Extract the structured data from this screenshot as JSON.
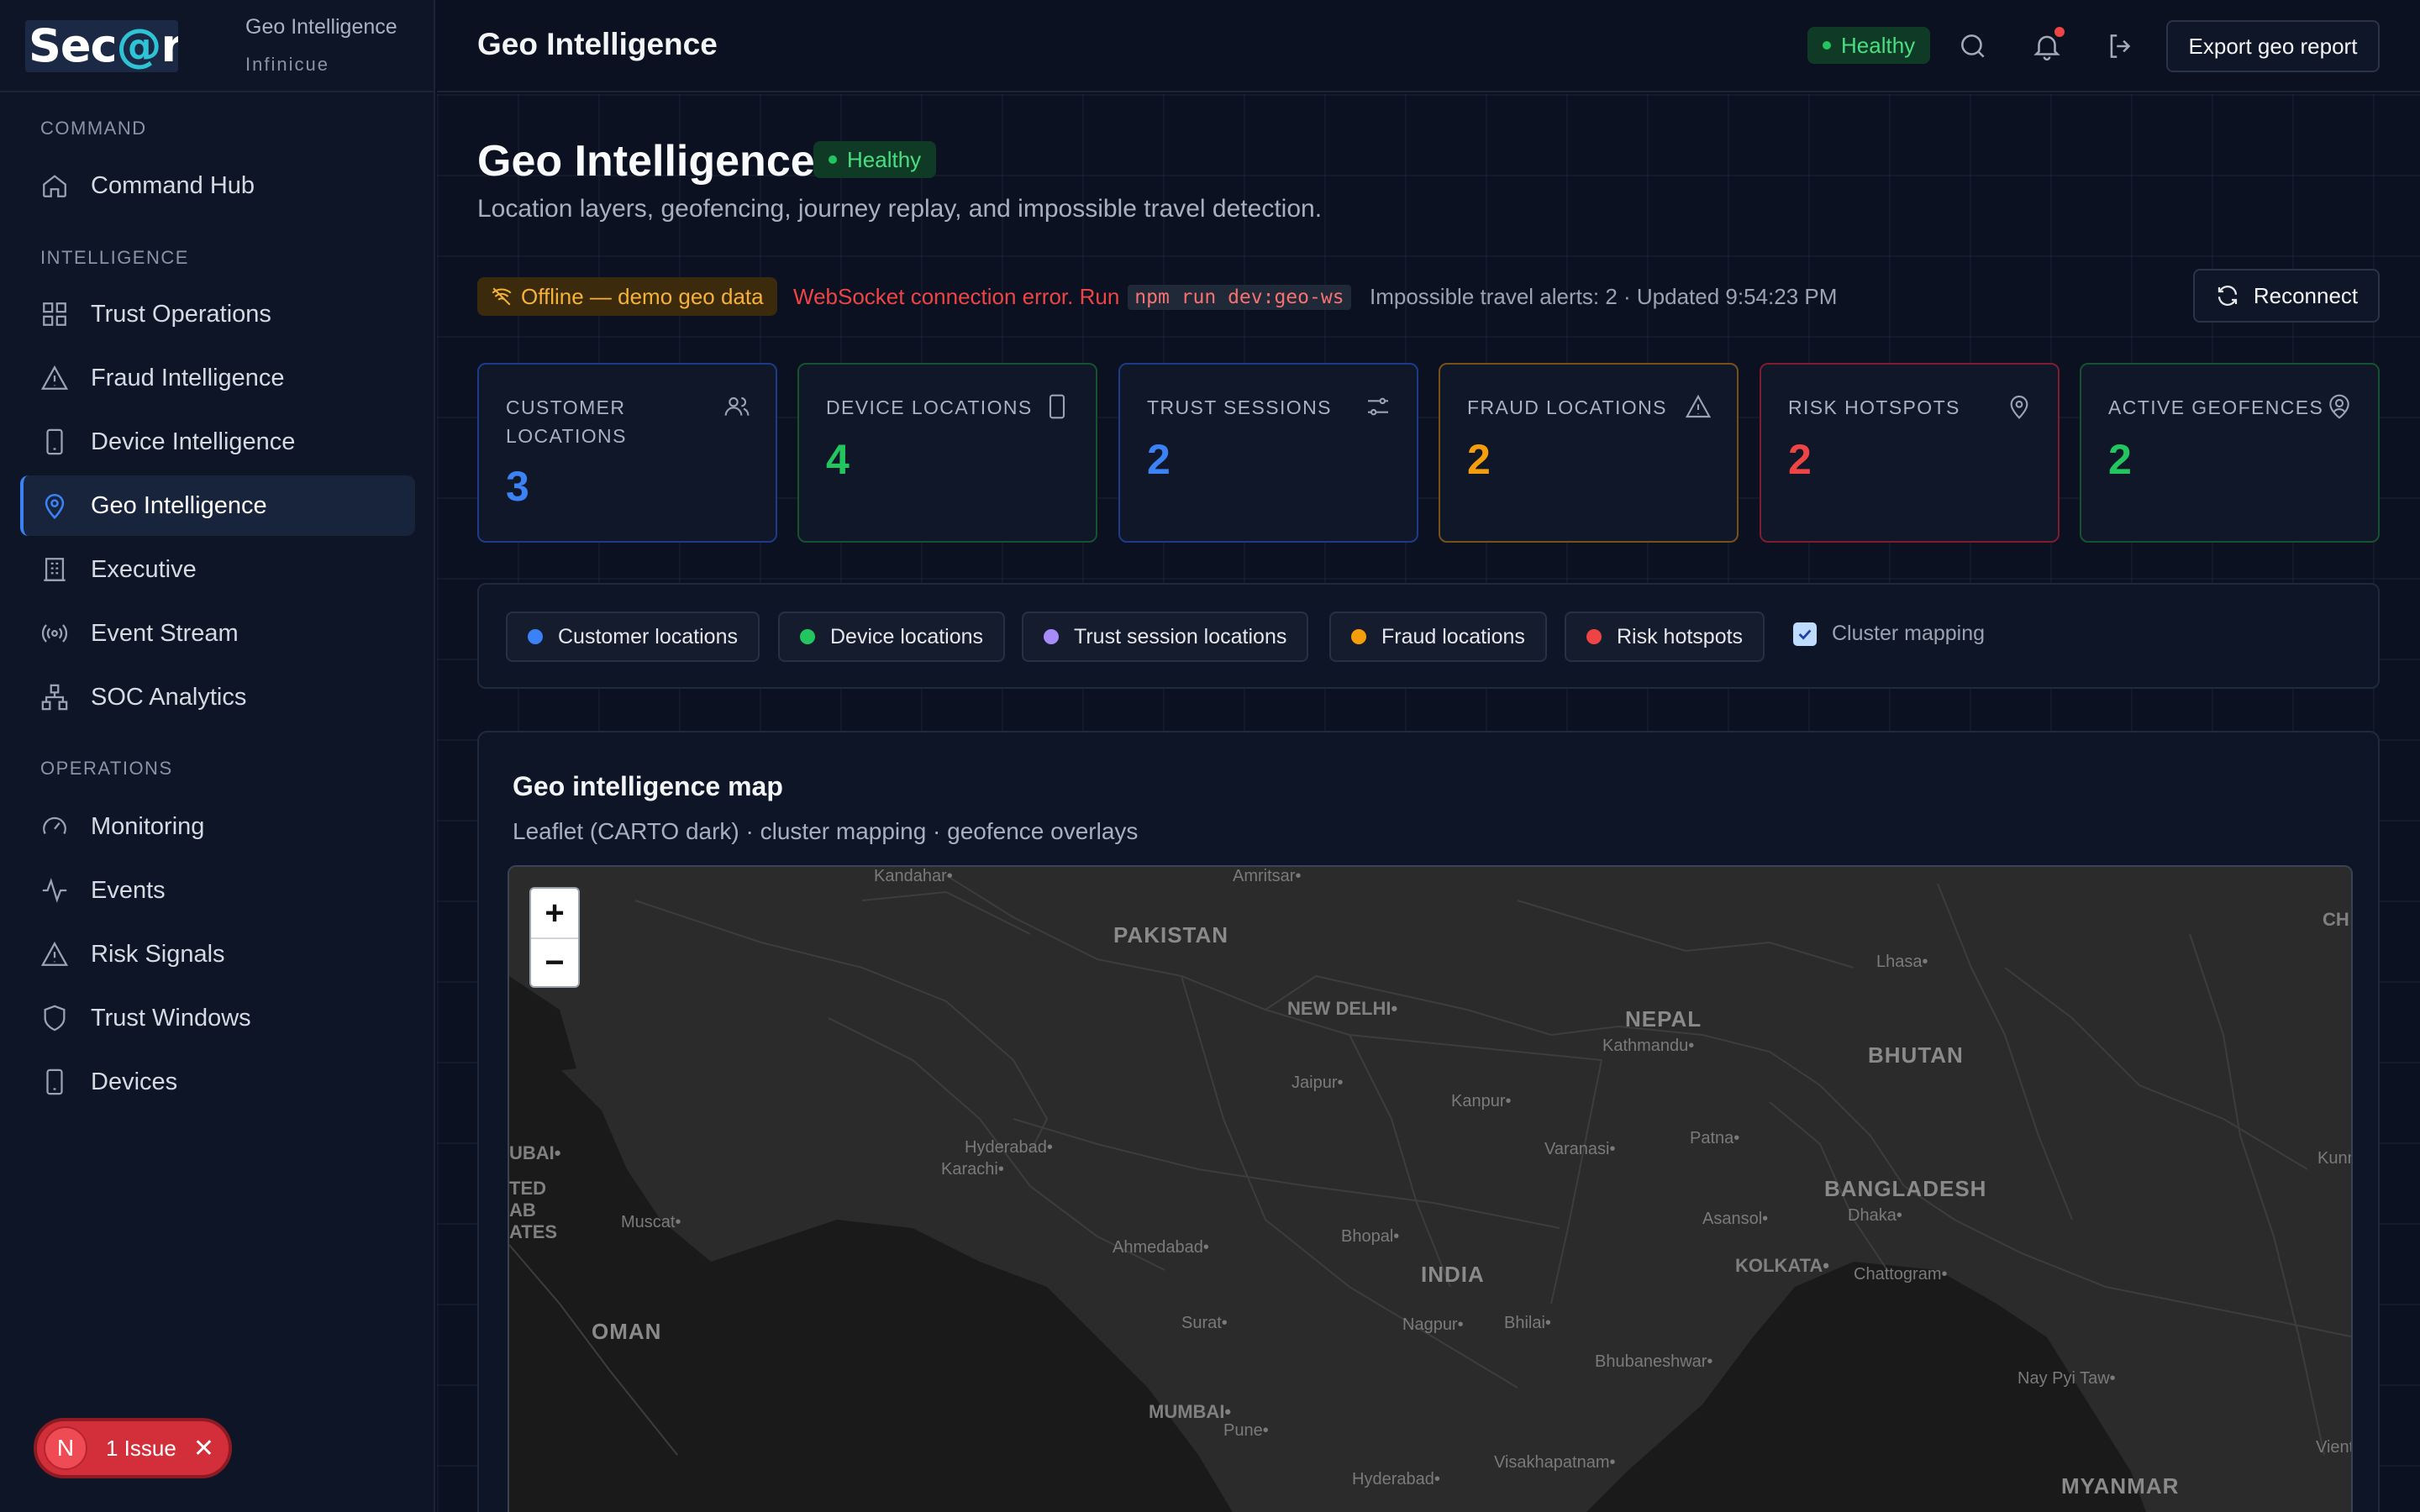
{
  "sidebar": {
    "logo": {
      "pre": "Sec",
      "at": "@",
      "post": "r"
    },
    "brand_title": "Geo Intelligence",
    "brand_sub": "Infinicue",
    "sections": [
      {
        "label": "COMMAND",
        "items": [
          {
            "label": "Command Hub",
            "icon": "home-icon"
          }
        ]
      },
      {
        "label": "INTELLIGENCE",
        "items": [
          {
            "label": "Trust Operations",
            "icon": "grid-icon"
          },
          {
            "label": "Fraud Intelligence",
            "icon": "warning-icon"
          },
          {
            "label": "Device Intelligence",
            "icon": "device-icon"
          },
          {
            "label": "Geo Intelligence",
            "icon": "map-pin-icon",
            "active": true
          },
          {
            "label": "Executive",
            "icon": "building-icon"
          },
          {
            "label": "Event Stream",
            "icon": "broadcast-icon"
          },
          {
            "label": "SOC Analytics",
            "icon": "network-icon"
          }
        ]
      },
      {
        "label": "OPERATIONS",
        "items": [
          {
            "label": "Monitoring",
            "icon": "gauge-icon"
          },
          {
            "label": "Events",
            "icon": "activity-icon"
          },
          {
            "label": "Risk Signals",
            "icon": "warning-icon"
          },
          {
            "label": "Trust Windows",
            "icon": "shield-icon"
          },
          {
            "label": "Devices",
            "icon": "device-icon"
          }
        ]
      }
    ],
    "issue": {
      "letter": "N",
      "label": "1 Issue"
    }
  },
  "topbar": {
    "title": "Geo Intelligence",
    "status": "Healthy",
    "export_label": "Export geo report"
  },
  "page": {
    "title": "Geo Intelligence",
    "status": "Healthy",
    "description": "Location layers, geofencing, journey replay, and impossible travel detection.",
    "offline_label": "Offline — demo geo data",
    "ws_error": "WebSocket connection error. Run",
    "ws_command": "npm run dev:geo-ws",
    "alerts_text": "Impossible travel alerts: 2 · Updated 9:54:23 PM",
    "reconnect_label": "Reconnect"
  },
  "stats": [
    {
      "label": "CUSTOMER LOCATIONS",
      "value": "3",
      "icon": "users-icon",
      "color": "#3b82f6",
      "border": "#1e3a8a"
    },
    {
      "label": "DEVICE LOCATIONS",
      "value": "4",
      "icon": "device-icon",
      "color": "#22c55e",
      "border": "#14532d"
    },
    {
      "label": "TRUST SESSIONS",
      "value": "2",
      "icon": "sliders-icon",
      "color": "#3b82f6",
      "border": "#1e3a8a"
    },
    {
      "label": "FRAUD LOCATIONS",
      "value": "2",
      "icon": "warning-icon",
      "color": "#f59e0b",
      "border": "#78501a"
    },
    {
      "label": "RISK HOTSPOTS",
      "value": "2",
      "icon": "map-pin-icon",
      "color": "#ef4444",
      "border": "#7f1d2d"
    },
    {
      "label": "ACTIVE GEOFENCES",
      "value": "2",
      "icon": "user-pin-icon",
      "color": "#22c55e",
      "border": "#14532d"
    }
  ],
  "layers": [
    {
      "label": "Customer locations",
      "color": "#3b82f6"
    },
    {
      "label": "Device locations",
      "color": "#22c55e"
    },
    {
      "label": "Trust session locations",
      "color": "#a78bfa"
    },
    {
      "label": "Fraud locations",
      "color": "#f59e0b"
    },
    {
      "label": "Risk hotspots",
      "color": "#ef4444"
    }
  ],
  "cluster": {
    "label": "Cluster mapping",
    "checked": true
  },
  "map": {
    "title": "Geo intelligence map",
    "subtitle": "Leaflet (CARTO dark) · cluster mapping · geofence overlays",
    "zoom_in": "+",
    "zoom_out": "−",
    "labels": [
      {
        "text": "Kandahar•",
        "kind": "small"
      },
      {
        "text": "Amritsar•",
        "kind": "small"
      },
      {
        "text": "PAKISTAN",
        "kind": "big"
      },
      {
        "text": "CH",
        "kind": "mid"
      },
      {
        "text": "Lhasa•",
        "kind": "small"
      },
      {
        "text": "NEW DELHI•",
        "kind": "mid"
      },
      {
        "text": "NEPAL",
        "kind": "big"
      },
      {
        "text": "Kathmandu•",
        "kind": "small"
      },
      {
        "text": "BHUTAN",
        "kind": "big"
      },
      {
        "text": "Jaipur•",
        "kind": "small"
      },
      {
        "text": "Kanpur•",
        "kind": "small"
      },
      {
        "text": "UBAI•",
        "kind": "mid"
      },
      {
        "text": "Hyderabad•",
        "kind": "small"
      },
      {
        "text": "Karachi•",
        "kind": "small"
      },
      {
        "text": "Varanasi•",
        "kind": "small"
      },
      {
        "text": "Patna•",
        "kind": "small"
      },
      {
        "text": "Kunmi",
        "kind": "small"
      },
      {
        "text": "TED",
        "kind": "mid"
      },
      {
        "text": "AB",
        "kind": "mid"
      },
      {
        "text": "ATES",
        "kind": "mid"
      },
      {
        "text": "BANGLADESH",
        "kind": "big"
      },
      {
        "text": "Dhaka•",
        "kind": "small"
      },
      {
        "text": "Asansol•",
        "kind": "small"
      },
      {
        "text": "Muscat•",
        "kind": "small"
      },
      {
        "text": "Ahmedabad•",
        "kind": "small"
      },
      {
        "text": "Bhopal•",
        "kind": "small"
      },
      {
        "text": "INDIA",
        "kind": "big"
      },
      {
        "text": "KOLKATA•",
        "kind": "mid"
      },
      {
        "text": "Chattogram•",
        "kind": "small"
      },
      {
        "text": "OMAN",
        "kind": "big"
      },
      {
        "text": "Surat•",
        "kind": "small"
      },
      {
        "text": "Nagpur•",
        "kind": "small"
      },
      {
        "text": "Bhilai•",
        "kind": "small"
      },
      {
        "text": "Bhubaneshwar•",
        "kind": "small"
      },
      {
        "text": "Nay Pyi Taw•",
        "kind": "small"
      },
      {
        "text": "MUMBAI•",
        "kind": "mid"
      },
      {
        "text": "Pune•",
        "kind": "small"
      },
      {
        "text": "Hyderabad•",
        "kind": "small"
      },
      {
        "text": "Visakhapatnam•",
        "kind": "small"
      },
      {
        "text": "MYANMAR",
        "kind": "big"
      },
      {
        "text": "Vientia",
        "kind": "small"
      }
    ]
  }
}
